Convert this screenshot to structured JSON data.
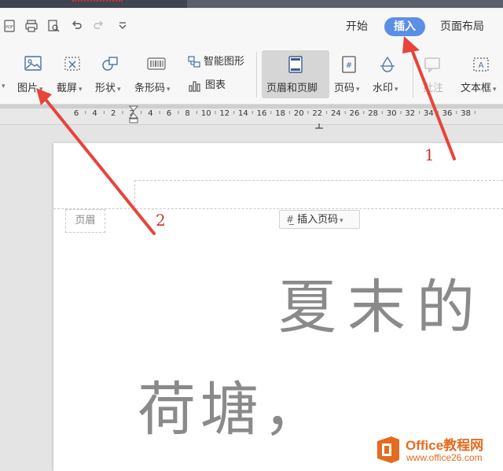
{
  "tabs": {
    "start": "开始",
    "insert": "插入",
    "page_layout": "页面布局"
  },
  "ribbon": {
    "picture": "图片",
    "screenshot": "截屏",
    "shape": "形状",
    "barcode": "条形码",
    "smart_art": "智能图形",
    "chart": "图表",
    "header_footer": "页眉和页脚",
    "page_number": "页码",
    "watermark": "水印",
    "comment": "批注",
    "text_box": "文本框"
  },
  "ruler": {
    "numbers": [
      "6",
      "4",
      "2",
      "2",
      "4",
      "6",
      "8",
      "10",
      "12",
      "14",
      "16",
      "18",
      "20",
      "22",
      "24",
      "26",
      "28",
      "30",
      "32",
      "34",
      "36",
      "38"
    ]
  },
  "document": {
    "header_label": "页眉",
    "insert_page_number": "插入页码",
    "line1": "夏末的",
    "line2": "荷塘，"
  },
  "annotations": {
    "one": "1",
    "two": "2"
  },
  "watermark": {
    "title": "Office教程网",
    "url": "www.office26.com"
  },
  "colors": {
    "accent": "#5b8ee6",
    "arrow": "#e8443a",
    "watermark": "#e56b1f"
  }
}
